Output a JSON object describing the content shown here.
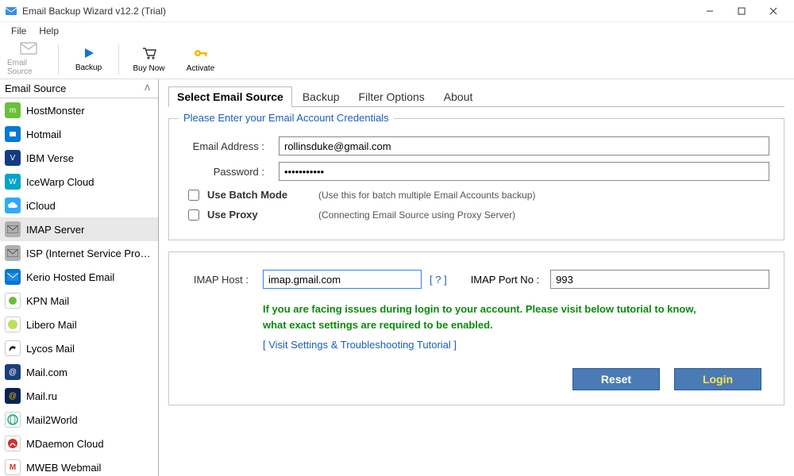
{
  "title": "Email Backup Wizard v12.2 (Trial)",
  "menu": {
    "file": "File",
    "help": "Help"
  },
  "toolbar": {
    "email_source": "Email Source",
    "backup": "Backup",
    "buy_now": "Buy Now",
    "activate": "Activate"
  },
  "sidebar": {
    "header": "Email Source",
    "items": [
      {
        "label": "HostMonster"
      },
      {
        "label": "Hotmail"
      },
      {
        "label": "IBM Verse"
      },
      {
        "label": "IceWarp Cloud"
      },
      {
        "label": "iCloud"
      },
      {
        "label": "IMAP Server",
        "selected": true
      },
      {
        "label": "ISP (Internet Service Provider)"
      },
      {
        "label": "Kerio Hosted Email"
      },
      {
        "label": "KPN Mail"
      },
      {
        "label": "Libero Mail"
      },
      {
        "label": "Lycos Mail"
      },
      {
        "label": "Mail.com"
      },
      {
        "label": "Mail.ru"
      },
      {
        "label": "Mail2World"
      },
      {
        "label": "MDaemon Cloud"
      },
      {
        "label": "MWEB Webmail"
      }
    ]
  },
  "tabs": {
    "select_source": "Select Email Source",
    "backup": "Backup",
    "filter": "Filter Options",
    "about": "About"
  },
  "form": {
    "legend": "Please Enter your Email Account Credentials",
    "email_label": "Email Address :",
    "email_value": "rollinsduke@gmail.com",
    "password_label": "Password :",
    "password_value": "•••••••••••",
    "batch_label": "Use Batch Mode",
    "batch_hint": "(Use this for batch multiple Email Accounts backup)",
    "proxy_label": "Use Proxy",
    "proxy_hint": "(Connecting Email Source using Proxy Server)",
    "imap_host_label": "IMAP Host :",
    "imap_host_value": "imap.gmail.com",
    "qmark": "[ ? ]",
    "imap_port_label": "IMAP Port No :",
    "imap_port_value": "993",
    "help_text_1": "If you are facing issues during login to your account. Please visit below tutorial to know,",
    "help_text_2": "what exact settings are required to be enabled.",
    "tutorial_link": "[ Visit Settings & Troubleshooting Tutorial ]",
    "reset_btn": "Reset",
    "login_btn": "Login"
  }
}
